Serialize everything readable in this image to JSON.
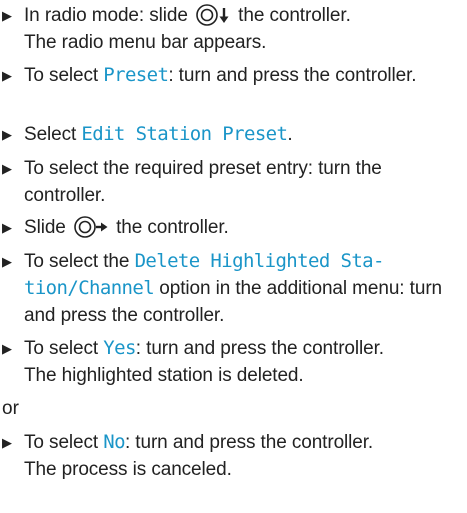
{
  "steps": [
    {
      "before": "In radio mode: slide ",
      "icon": "controller-slide-down-icon",
      "after": " the controller.",
      "result": "The radio menu bar appears."
    },
    {
      "before": "To select ",
      "keyword": "Preset",
      "after": ": turn and press the controller."
    },
    {
      "before": "Select ",
      "keyword": "Edit Station Preset",
      "after": "."
    },
    {
      "text": "To select the required preset entry: turn the controller."
    },
    {
      "before": "Slide ",
      "icon": "controller-slide-right-icon",
      "after": " the controller."
    },
    {
      "before": "To select the ",
      "keyword_line1": "Delete Highlighted Sta-",
      "keyword_line2": "tion/Channel",
      "after": " option in the additional menu: turn and press the controller."
    },
    {
      "before": "To select ",
      "keyword": "Yes",
      "after": ": turn and press the controller.",
      "result": "The highlighted station is deleted."
    },
    {
      "before": "To select ",
      "keyword": "No",
      "after": ": turn and press the controller.",
      "result": "The process is canceled."
    }
  ],
  "or_text": "or",
  "bullet": "▶",
  "colors": {
    "text": "#222222",
    "keyword": "#1a95c8"
  }
}
